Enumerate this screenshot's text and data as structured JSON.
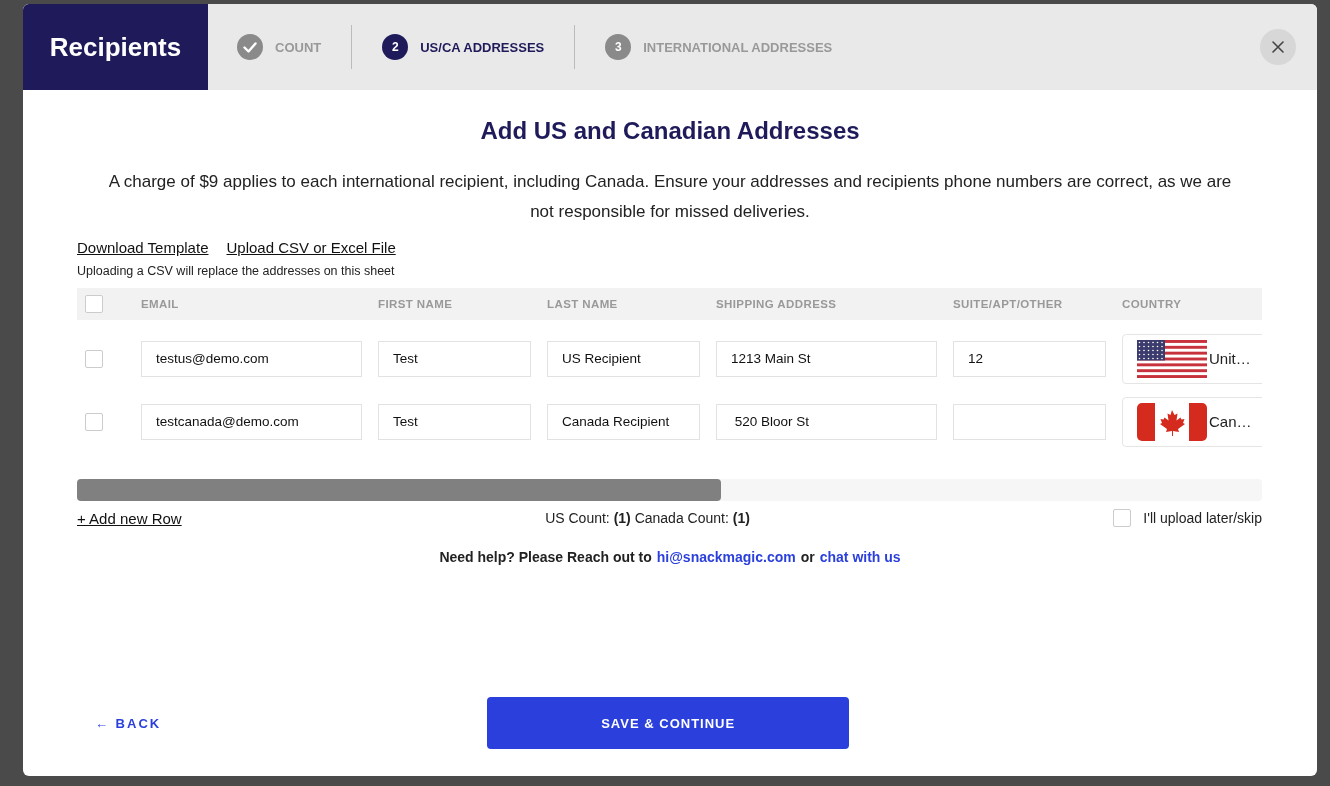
{
  "dialog": {
    "title": "Recipients"
  },
  "steps": [
    {
      "label": "COUNT",
      "kind": "done"
    },
    {
      "number": "2",
      "label": "US/CA ADDRESSES",
      "kind": "current"
    },
    {
      "number": "3",
      "label": "INTERNATIONAL ADDRESSES",
      "kind": "upcoming"
    }
  ],
  "heading": "Add US and Canadian Addresses",
  "notice": "A charge of $9 applies to each international recipient, including Canada. Ensure your addresses and recipients phone numbers are correct, as we are not responsible for missed deliveries.",
  "links": [
    "Download Template",
    "Upload CSV or Excel File"
  ],
  "upload_note": "Uploading a CSV will replace the addresses on this sheet",
  "table": {
    "select_all": {
      "checked": false
    },
    "columns": [
      "EMAIL",
      "FIRST NAME",
      "LAST NAME",
      "SHIPPING ADDRESS",
      "SUITE/APT/OTHER",
      "COUNTRY"
    ],
    "rows": [
      {
        "checked": false,
        "email": "testus@demo.com",
        "first_name": "Test",
        "last_name": "US Recipient",
        "shipping_address": "1213 Main St",
        "suite": "12",
        "country": {
          "kind": "us",
          "label": "Unit…"
        }
      },
      {
        "checked": false,
        "email": "testcanada@demo.com",
        "first_name": "Test",
        "last_name": "Canada Recipient",
        "shipping_address": " 520 Bloor St",
        "suite": "",
        "country": {
          "kind": "ca",
          "label": "Can…"
        }
      }
    ]
  },
  "add_row": "+ Add new Row",
  "counts": "US Count: **(1)** Canada Count: **(1)**",
  "skip": {
    "label": "I'll upload later/skip",
    "checked": false
  },
  "help": {
    "text": "Need help? Please Reach out to",
    "email": "hi@snackmagic.com",
    "or": "or",
    "chat": "chat with us"
  },
  "back": "← BACK",
  "save": "SAVE & CONTINUE"
}
